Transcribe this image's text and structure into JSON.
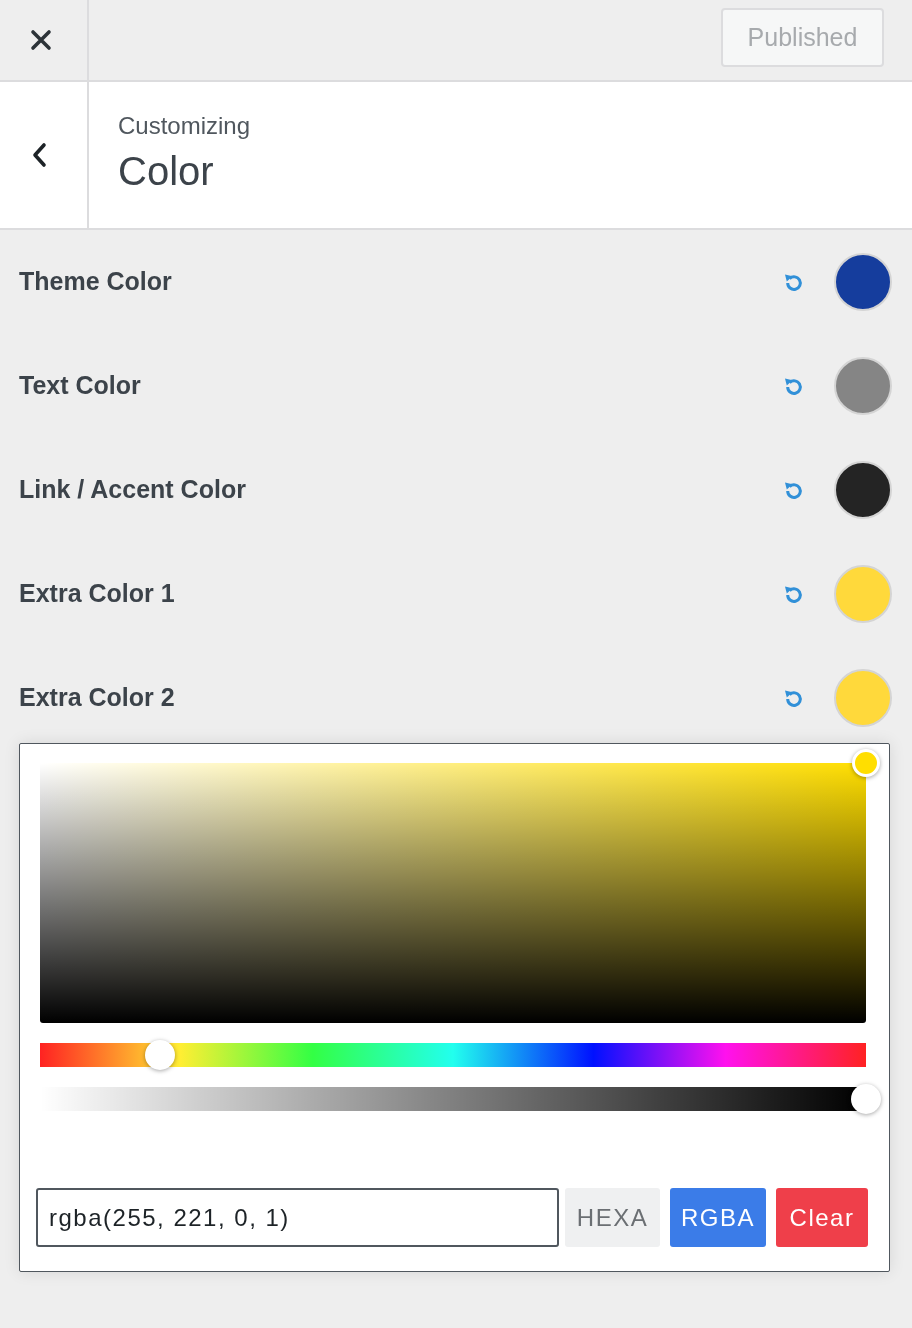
{
  "top_bar": {
    "publish_button": {
      "label": "Published",
      "disabled": true
    }
  },
  "header": {
    "subtitle": "Customizing",
    "title": "Color"
  },
  "settings": [
    {
      "label": "Theme Color",
      "color": "#153d9d"
    },
    {
      "label": "Text Color",
      "color": "#858585"
    },
    {
      "label": "Link / Accent Color",
      "color": "#242424"
    },
    {
      "label": "Extra Color 1",
      "color": "#ffd93b"
    },
    {
      "label": "Extra Color 2",
      "color": "#ffd93b",
      "picker": {
        "saturation": {
          "level": 1
        },
        "brightness": {
          "level": 1
        },
        "hue": {
          "level": 0.145
        },
        "alpha": {
          "level": 1
        },
        "input": {
          "value": "rgba(255, 221, 0, 1)"
        },
        "formats": [
          {
            "label": "HEXA",
            "selected": false
          },
          {
            "label": "RGBA",
            "selected": true
          }
        ],
        "clear_button": {
          "label": "Clear"
        }
      }
    }
  ]
}
